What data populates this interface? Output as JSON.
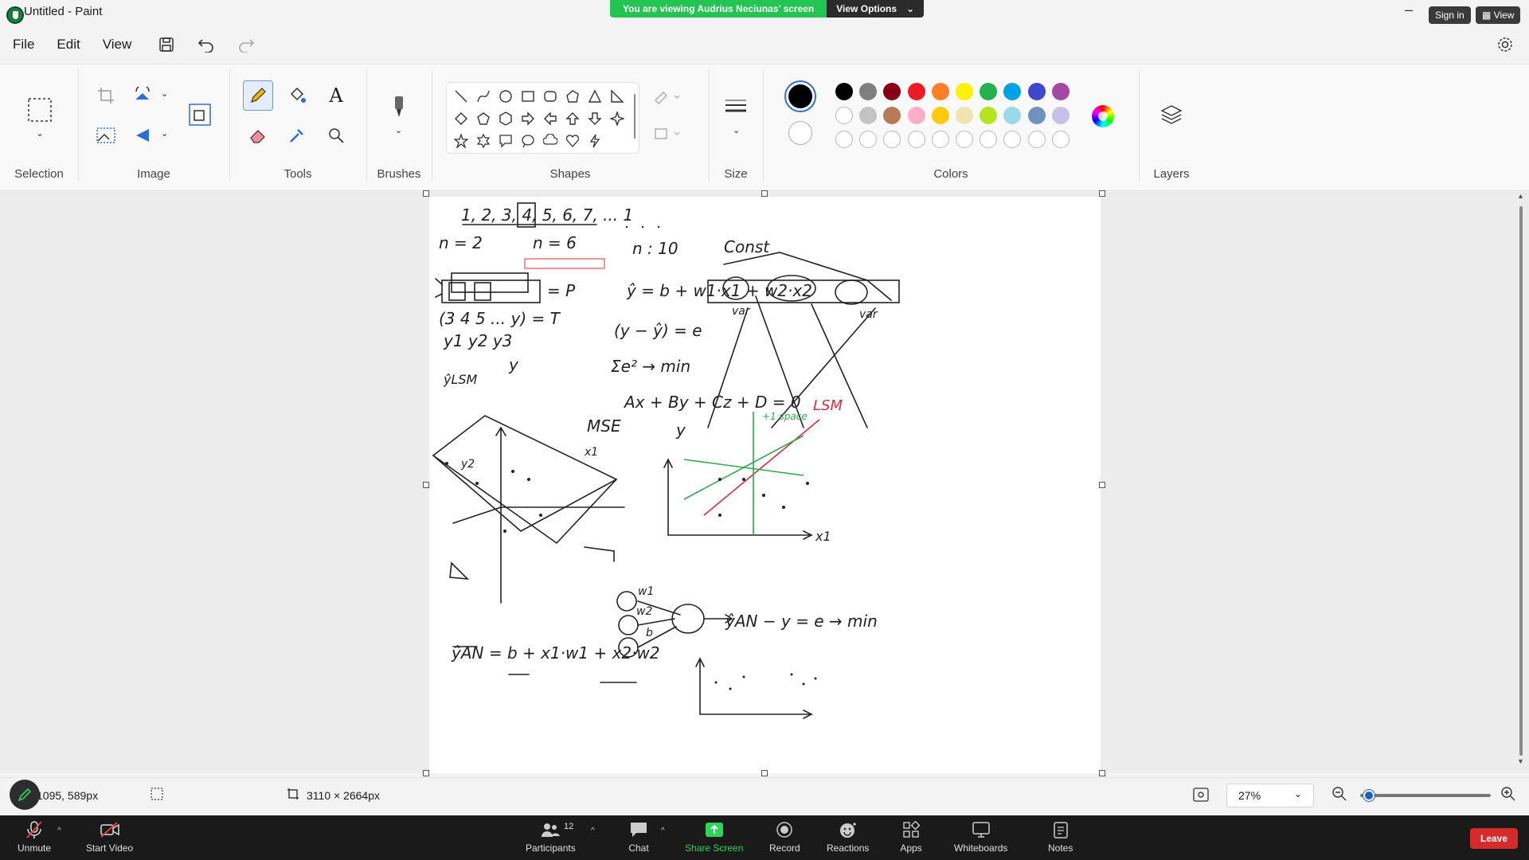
{
  "window": {
    "title": "Untitled - Paint",
    "viewing_banner": "You are viewing Audrius Neciunas' screen",
    "view_options": "View Options",
    "sign_in": "Sign in",
    "view": "View"
  },
  "menu": {
    "items": [
      "File",
      "Edit",
      "View"
    ]
  },
  "ribbon": {
    "groups": {
      "selection": "Selection",
      "image": "Image",
      "tools": "Tools",
      "brushes": "Brushes",
      "shapes": "Shapes",
      "size": "Size",
      "colors": "Colors",
      "layers": "Layers"
    },
    "active_tool": "pencil",
    "primary_color": "#000000",
    "secondary_color": "#ffffff",
    "palette_row1": [
      "#000000",
      "#7f7f7f",
      "#880015",
      "#ed1c24",
      "#ff7f27",
      "#fff200",
      "#22b14c",
      "#00a2e8",
      "#3f48cc",
      "#a349a4"
    ],
    "palette_row2": [
      "#ffffff",
      "#c3c3c3",
      "#b97a57",
      "#ffaec9",
      "#ffc90e",
      "#efe4b0",
      "#b5e61d",
      "#99d9ea",
      "#7092be",
      "#c8bfe7"
    ]
  },
  "canvas": {
    "notes": {
      "seq": "1, 2, 3, 4, 5, 6, 7, ... 1",
      "n2": "n = 2",
      "n6": "n = 6",
      "n10": "n : 10",
      "const": "Const",
      "yhat_lr": "ŷ = b + w1·x1 + w2·x2",
      "var1": "var",
      "var2": "var",
      "P": "= P",
      "T": "(3 4 5 ... y) = T",
      "y123": "y1 y2 y3",
      "err": "(y − ŷ) = e",
      "sum_e2": "Σe² → min",
      "plane": "Ax + By + Cz + D = 0",
      "lsm": "LSM",
      "y_axis": "y",
      "ylsm": "ŷLSM",
      "mse": "MSE",
      "x1_axis": "x1",
      "y2_label": "y2",
      "x1_b": "x1",
      "green_note": "+1 space",
      "neuron": "ŷAN − y = e → min",
      "yan_formula": "ŷAN = b + x1·w1 + x2·w2",
      "w1": "w1",
      "w2": "w2",
      "b": "b"
    }
  },
  "status": {
    "cursor_pos": "1095, 589px",
    "canvas_size": "3110 × 2664px",
    "zoom": "27%"
  },
  "meeting": {
    "unmute": "Unmute",
    "start_video": "Start Video",
    "participants": "Participants",
    "participants_count": "12",
    "chat": "Chat",
    "share_screen": "Share Screen",
    "record": "Record",
    "reactions": "Reactions",
    "apps": "Apps",
    "whiteboards": "Whiteboards",
    "notes": "Notes",
    "leave": "Leave"
  }
}
